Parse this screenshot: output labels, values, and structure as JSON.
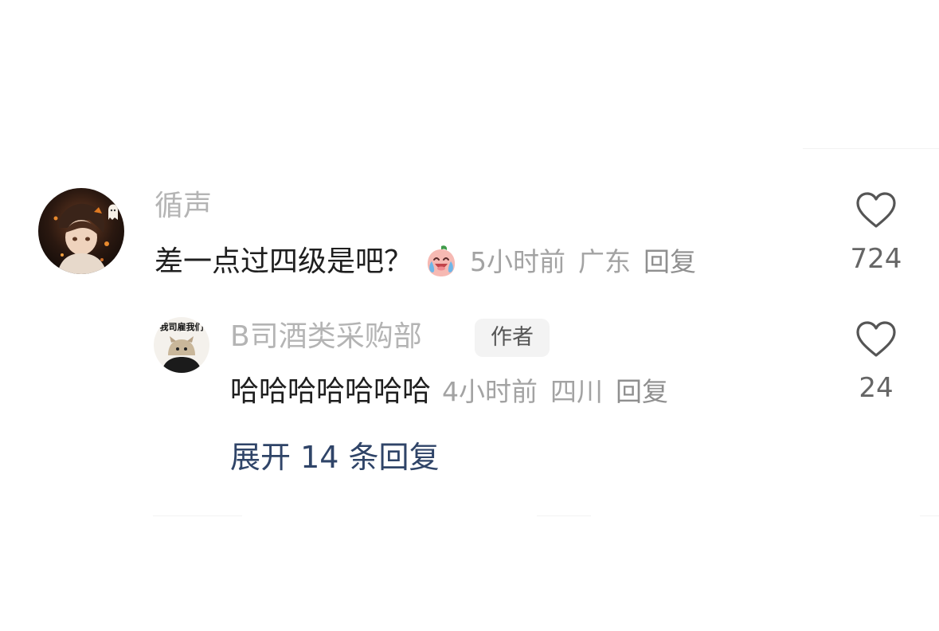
{
  "comment": {
    "username": "循声",
    "text": "差一点过四级是吧？",
    "emoji": "crying-laughing-peach-emoji",
    "time": "5小时前",
    "location": "广东",
    "reply_label": "回复",
    "likes": "724"
  },
  "reply": {
    "username": "B司酒类采购部",
    "author_badge": "作者",
    "avatar_text": "我司雇我们",
    "text": "哈哈哈哈哈哈哈",
    "time": "4小时前",
    "location": "四川",
    "reply_label": "回复",
    "likes": "24"
  },
  "expand_replies": "展开 14 条回复",
  "colors": {
    "username": "#b4b4b4",
    "meta": "#a3a3a3",
    "link": "#2f4468",
    "badge_bg": "#f3f3f3"
  }
}
